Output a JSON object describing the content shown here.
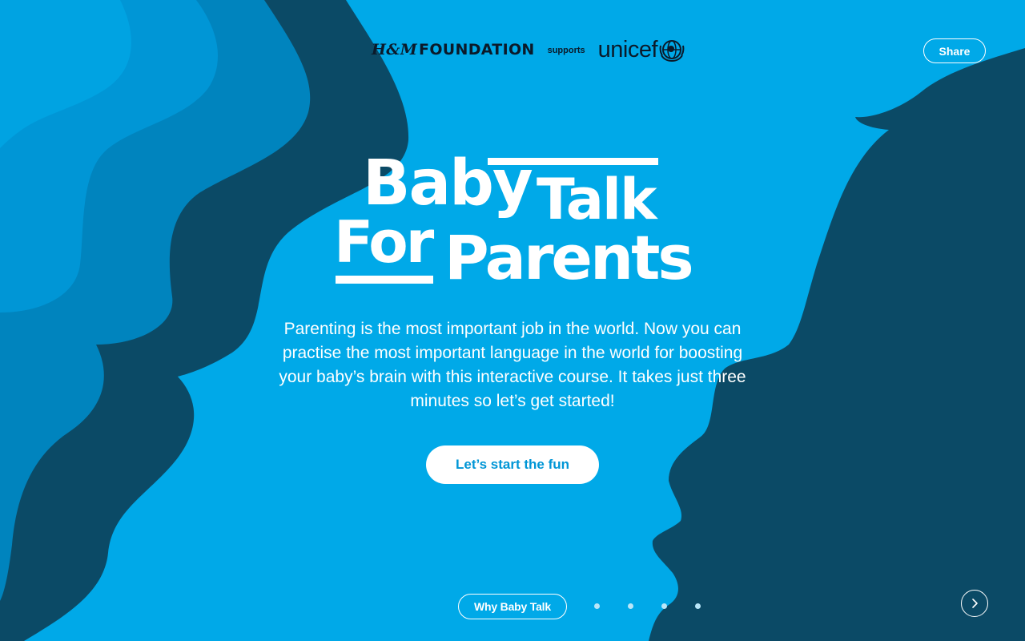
{
  "header": {
    "partner_logo_text": "FOUNDATION",
    "partner_logo_mark": "H&M",
    "supports_label": "supports",
    "unicef_text": "unicef",
    "share_label": "Share"
  },
  "hero": {
    "title_words": [
      "Baby",
      "Talk",
      "For",
      "Parents"
    ],
    "description": "Parenting is the most important job in the world. Now you can practise the most important language in the world for boosting your baby’s brain with this interactive course. It takes just three minutes so let’s get started!",
    "cta_label": "Let’s start the fun"
  },
  "footer_nav": {
    "section_label": "Why Baby Talk",
    "dots_count": 4,
    "next_icon": "chevron-right-icon"
  },
  "colors": {
    "background": "#00a9e8",
    "wave_dark": "#0b4a66",
    "wave_mid": "#0084be",
    "wave_light": "#0096d6",
    "accent_text": "#0096d6"
  }
}
